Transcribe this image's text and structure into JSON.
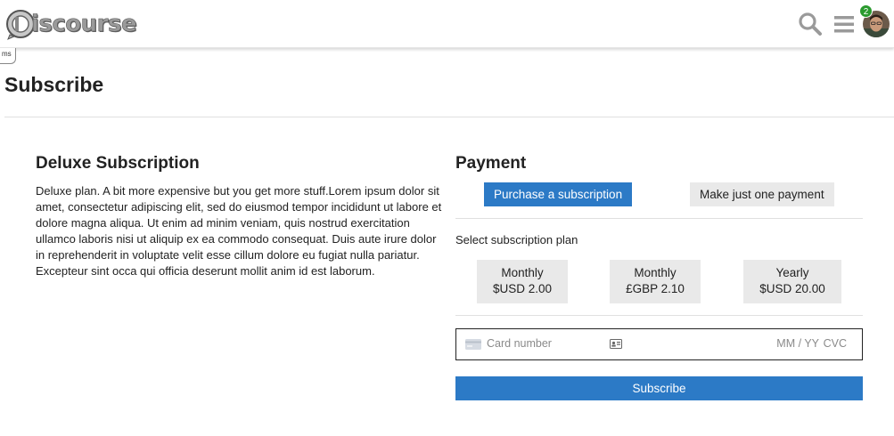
{
  "header": {
    "logo_text": "iscourse",
    "notification_count": "2"
  },
  "icons": {
    "logo": "discourse-logo-icon",
    "search": "search-icon",
    "menu": "hamburger-menu-icon",
    "avatar": "user-avatar",
    "card": "card-brand-icon",
    "contact": "contact-card-icon"
  },
  "tooltip": {
    "text": "ms"
  },
  "page": {
    "title": "Subscribe"
  },
  "plan": {
    "title": "Deluxe Subscription",
    "description": "Deluxe plan. A bit more expensive but you get more stuff.Lorem ipsum dolor sit amet, consectetur adipiscing elit, sed do eiusmod tempor incididunt ut labore et dolore magna aliqua. Ut enim ad minim veniam, quis nostrud exercitation ullamco laboris nisi ut aliquip ex ea commodo consequat. Duis aute irure dolor in reprehenderit in voluptate velit esse cillum dolore eu fugiat nulla pariatur. Excepteur sint occa qui officia deserunt mollit anim id est laborum."
  },
  "payment": {
    "title": "Payment",
    "tabs": [
      {
        "label": "Purchase a subscription",
        "active": true
      },
      {
        "label": "Make just one payment",
        "active": false
      }
    ],
    "select_label": "Select subscription plan",
    "options": [
      {
        "interval": "Monthly",
        "price": "$USD 2.00"
      },
      {
        "interval": "Monthly",
        "price": "£GBP 2.10"
      },
      {
        "interval": "Yearly",
        "price": "$USD 20.00"
      }
    ],
    "card": {
      "number_placeholder": "Card number",
      "expiry_placeholder": "MM / YY",
      "cvc_placeholder": "CVC"
    },
    "submit_label": "Subscribe"
  },
  "colors": {
    "primary": "#2c7ac6",
    "secondary_button": "#e9e9e9",
    "badge": "#2a9a2e",
    "text": "#222222",
    "placeholder": "#8a8a8a"
  }
}
